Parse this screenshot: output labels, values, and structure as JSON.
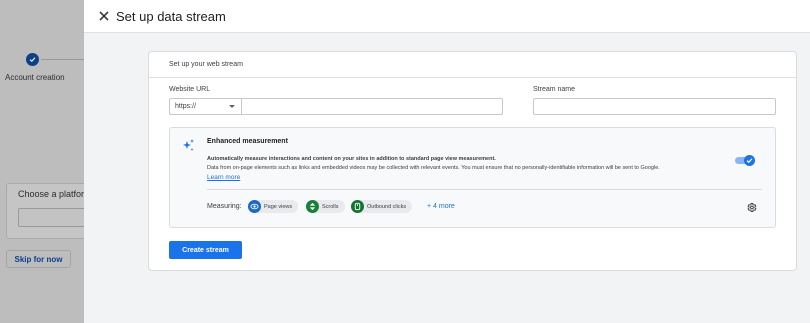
{
  "background": {
    "step_label": "Account creation",
    "card_title": "Choose a platform",
    "skip_label": "Skip for now"
  },
  "dialog": {
    "title": "Set up data stream",
    "section_title": "Set up your web stream",
    "website_url_label": "Website URL",
    "protocol_value": "https://",
    "url_value": "",
    "stream_name_label": "Stream name",
    "stream_name_value": "",
    "enhanced": {
      "title": "Enhanced measurement",
      "desc_bold": "Automatically measure interactions and content on your sites in addition to standard page view measurement.",
      "desc": "Data from on-page elements such as links and embedded videos may be collected with relevant events. You must ensure that no personally-identifiable information will be sent to Google.",
      "learn_more": "Learn more",
      "toggle_on": true,
      "measuring_label": "Measuring:",
      "chips": [
        {
          "label": "Page views",
          "icon": "eye-icon"
        },
        {
          "label": "Scrolls",
          "icon": "scroll-icon"
        },
        {
          "label": "Outbound clicks",
          "icon": "outbound-click-icon"
        }
      ],
      "more_label": "+ 4 more"
    },
    "create_button": "Create stream"
  },
  "colors": {
    "accent": "#1a73e8",
    "chip_icon_primary": "#1967d2",
    "chip_icon_green": "#188038",
    "chip_icon_teal": "#137333"
  }
}
